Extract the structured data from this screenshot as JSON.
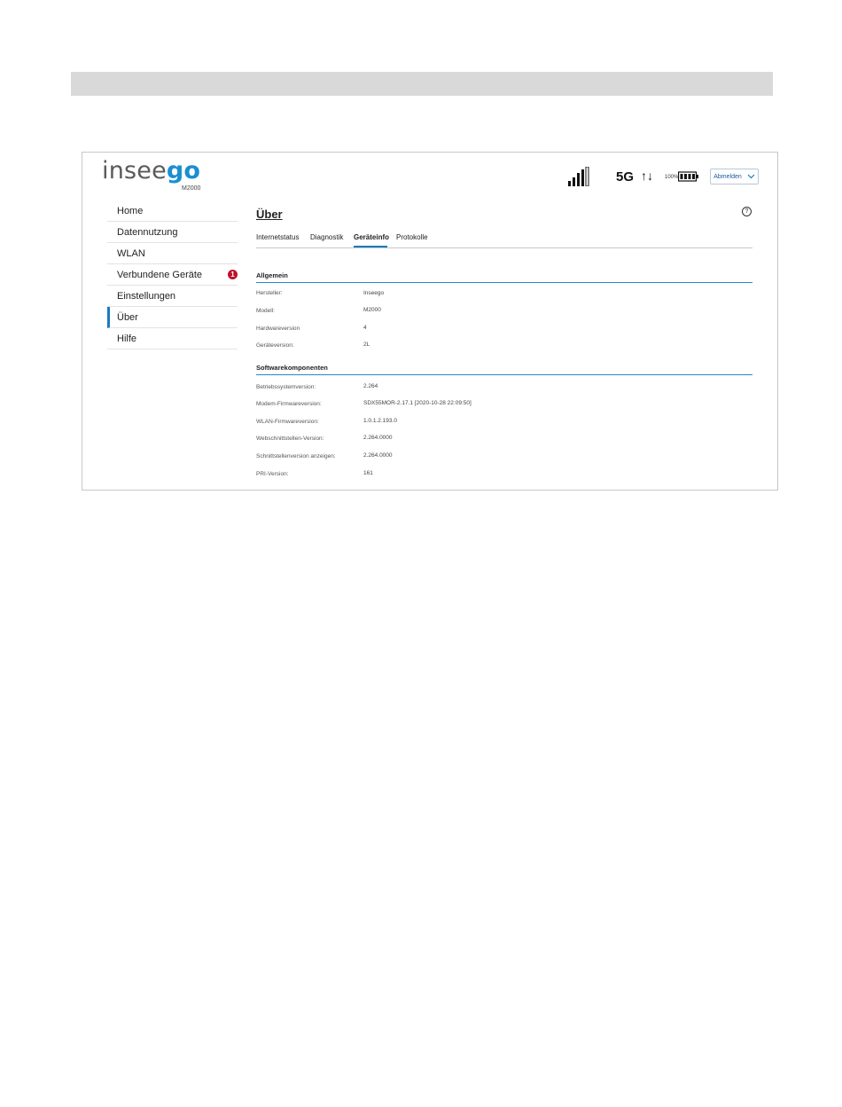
{
  "header": {
    "logo_prefix": "insee",
    "logo_suffix": "go",
    "model": "M2000",
    "network": "5G",
    "arrows": "↑↓",
    "battery_percent": "100%",
    "logout_label": "Abmelden",
    "signal_icon": "signal-bars-icon",
    "battery_icon": "battery-icon"
  },
  "sidebar": {
    "items": [
      {
        "label": "Home"
      },
      {
        "label": "Datennutzung"
      },
      {
        "label": "WLAN"
      },
      {
        "label": "Verbundene Geräte",
        "badge": "1"
      },
      {
        "label": "Einstellungen"
      },
      {
        "label": "Über",
        "active": true
      },
      {
        "label": "Hilfe"
      }
    ]
  },
  "main": {
    "title": "Über",
    "help": "?",
    "tabs": [
      {
        "label": "Internetstatus"
      },
      {
        "label": "Diagnostik"
      },
      {
        "label": "Geräteinfo",
        "active": true
      },
      {
        "label": "Protokolle"
      }
    ],
    "general": {
      "title": "Allgemein",
      "rows": [
        {
          "label": "Hersteller:",
          "value": "Inseego"
        },
        {
          "label": "Modell:",
          "value": "M2000"
        },
        {
          "label": "Hardwareversion",
          "value": "4"
        },
        {
          "label": "Geräteversion:",
          "value": "2L"
        }
      ]
    },
    "software": {
      "title": "Softwarekomponenten",
      "rows": [
        {
          "label": "Betriebssystemversion:",
          "value": "2.264"
        },
        {
          "label": "Modem-Firmwareversion:",
          "value": "SDX55MOR-2.17.1 [2020-10-28 22:09:50]"
        },
        {
          "label": "WLAN-Firmwareversion:",
          "value": "1.0.1.2.193.0"
        },
        {
          "label": "Webschnittstellen-Version:",
          "value": "2.264.0000"
        },
        {
          "label": "Schnittstellenversion anzeigen:",
          "value": "2.264.0000"
        },
        {
          "label": "PRI-Version:",
          "value": "161"
        }
      ]
    }
  },
  "colors": {
    "accent": "#1a7bc0",
    "badge": "#c0102a",
    "top_bar": "#d9d9d9"
  }
}
